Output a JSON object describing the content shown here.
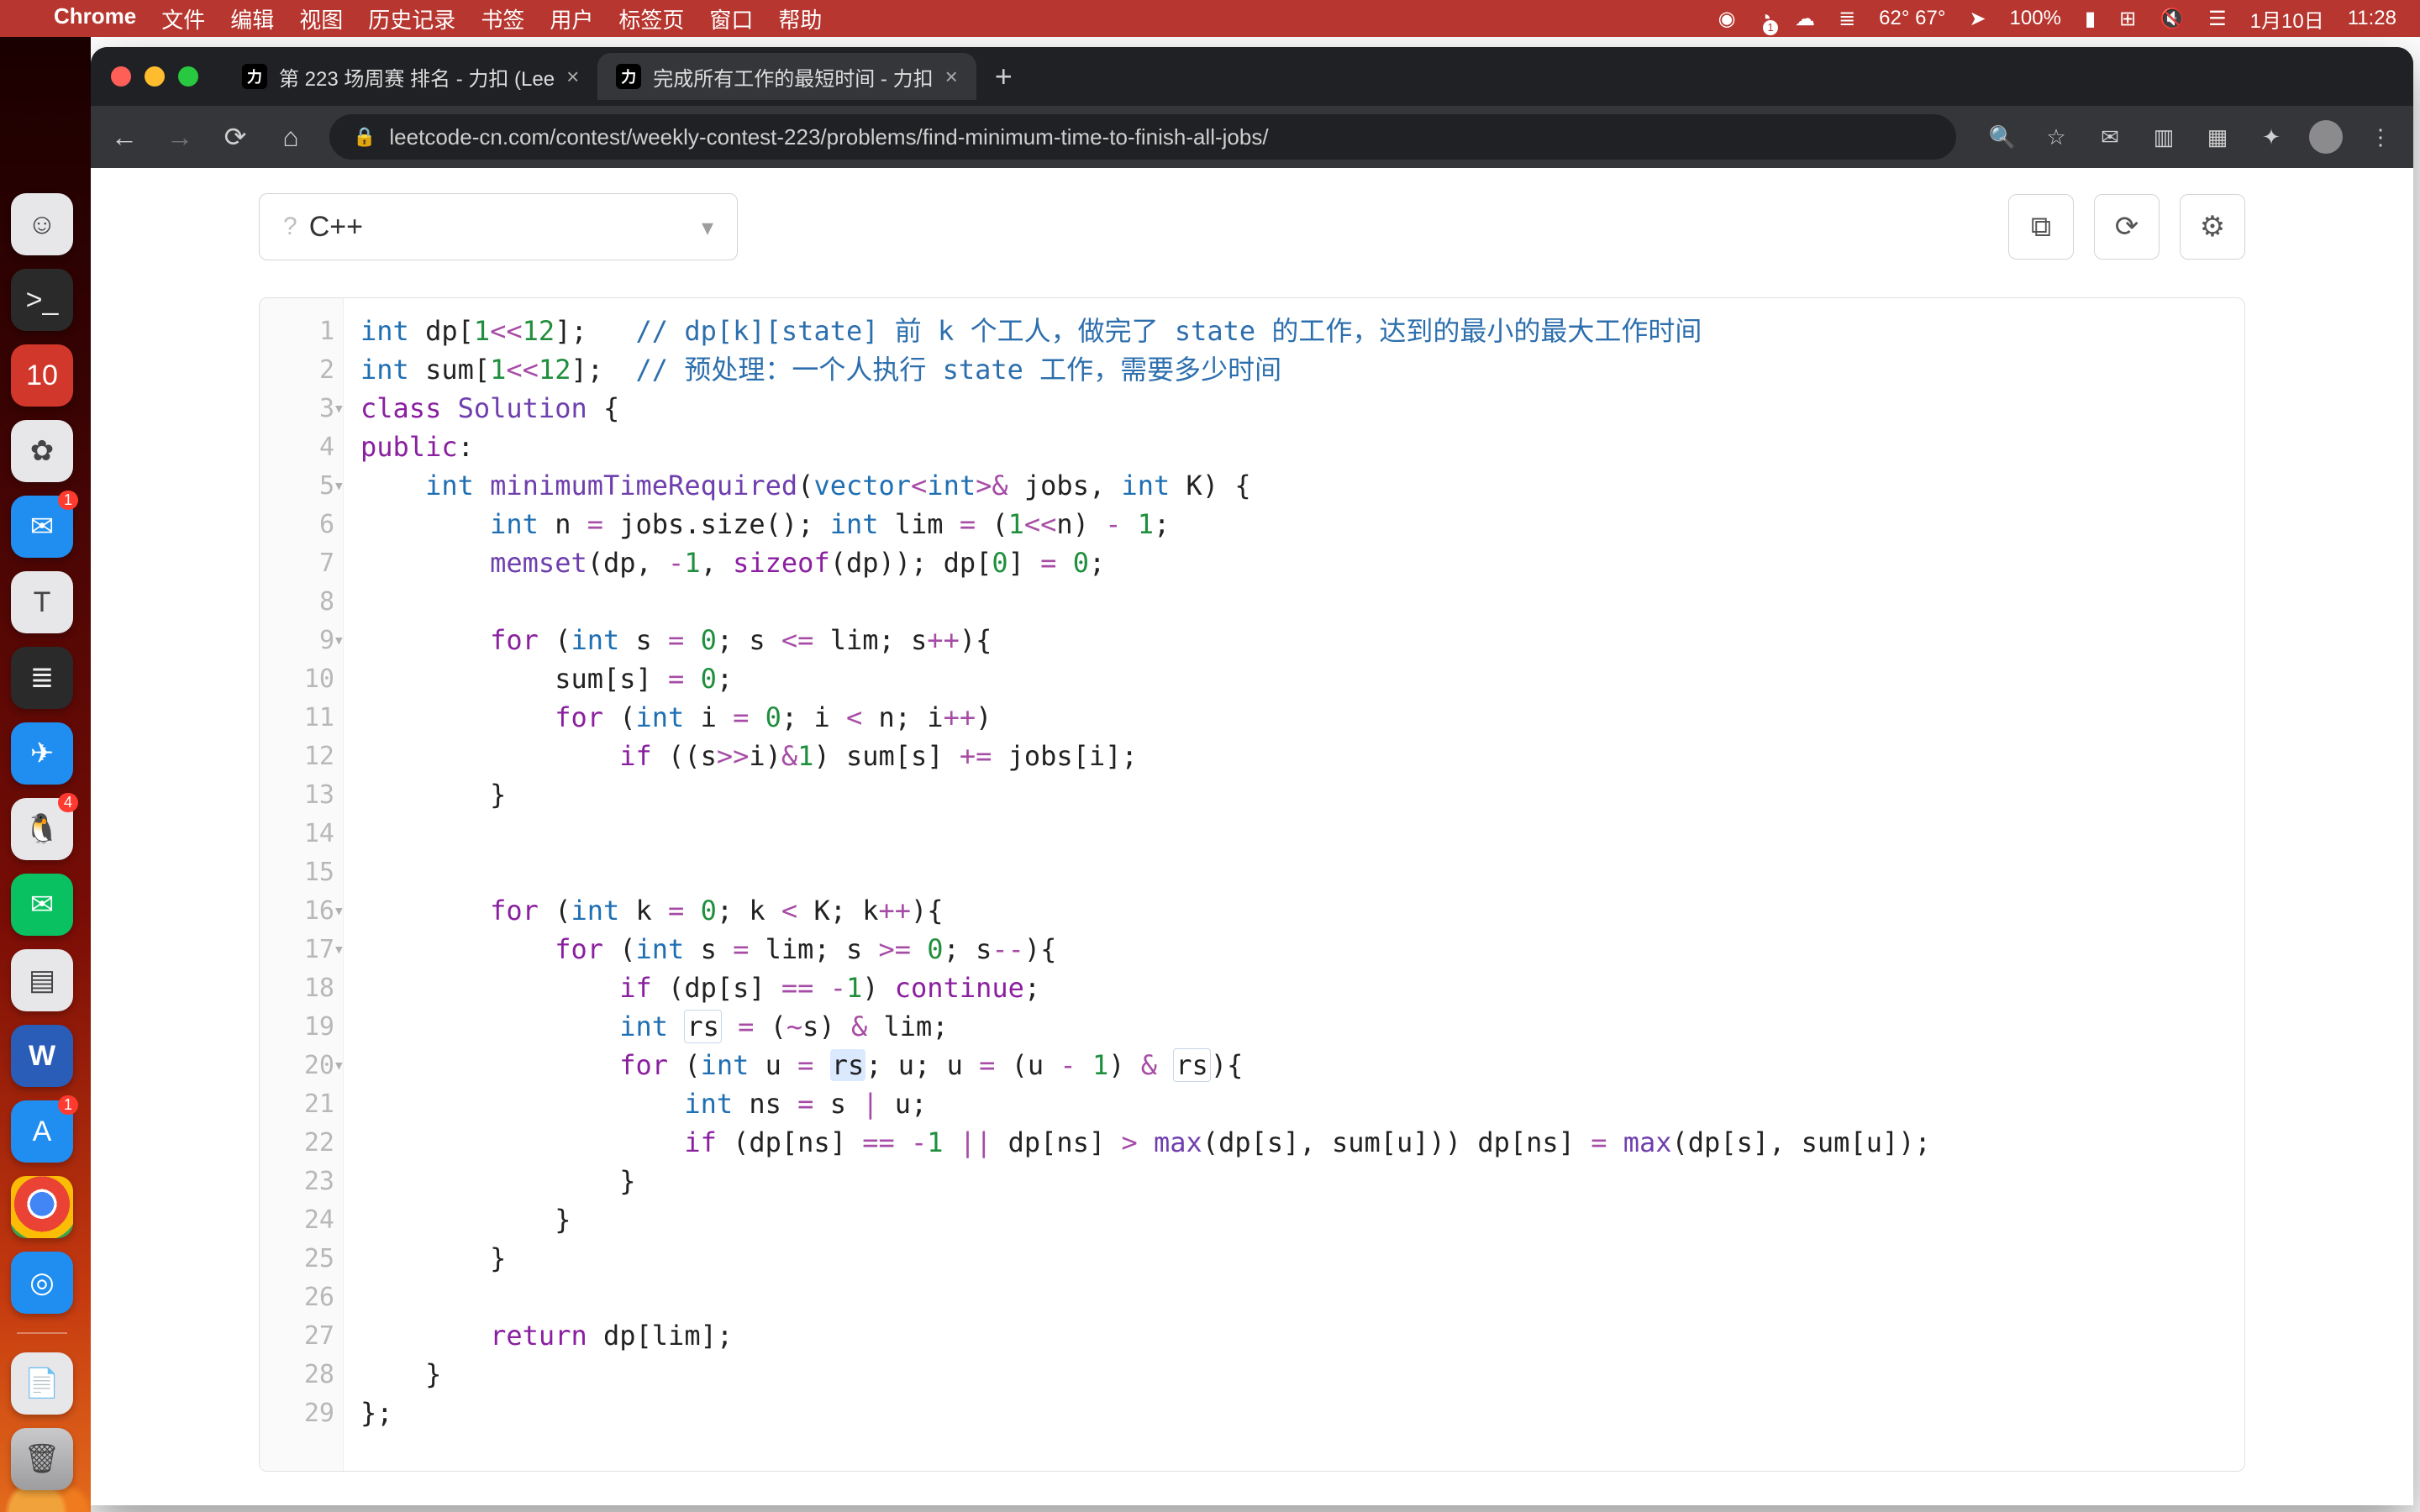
{
  "menubar": {
    "app": "Chrome",
    "menus": [
      "文件",
      "编辑",
      "视图",
      "历史记录",
      "书签",
      "用户",
      "标签页",
      "窗口",
      "帮助"
    ],
    "temp": "62° 67°",
    "battery": "100%",
    "date": "1月10日",
    "time": "11:28"
  },
  "chrome": {
    "tabs": [
      {
        "title": "第 223 场周赛 排名 - 力扣 (Lee",
        "active": false
      },
      {
        "title": "完成所有工作的最短时间 - 力扣",
        "active": true
      }
    ],
    "url": "leetcode-cn.com/contest/weekly-contest-223/problems/find-minimum-time-to-finish-all-jobs/"
  },
  "editor_toolbar": {
    "language": "C++"
  },
  "code_lines": [
    {
      "n": 1,
      "fold": "",
      "tokens": [
        [
          "type",
          "int"
        ],
        [
          "",
          " dp["
        ],
        [
          "num",
          "1"
        ],
        [
          "op",
          "<<"
        ],
        [
          "num",
          "12"
        ],
        [
          "",
          "];   "
        ],
        [
          "com",
          "// dp[k][state] 前 k 个工人，做完了 state 的工作，达到的最小的最大工作时间"
        ]
      ]
    },
    {
      "n": 2,
      "fold": "",
      "tokens": [
        [
          "type",
          "int"
        ],
        [
          "",
          " sum["
        ],
        [
          "num",
          "1"
        ],
        [
          "op",
          "<<"
        ],
        [
          "num",
          "12"
        ],
        [
          "",
          "];  "
        ],
        [
          "com",
          "// 预处理：一个人执行 state 工作，需要多少时间"
        ]
      ]
    },
    {
      "n": 3,
      "fold": "▾",
      "tokens": [
        [
          "kw",
          "class"
        ],
        [
          "",
          " "
        ],
        [
          "fn",
          "Solution"
        ],
        [
          "",
          " {"
        ]
      ]
    },
    {
      "n": 4,
      "fold": "",
      "tokens": [
        [
          "kw",
          "public"
        ],
        [
          "",
          ":"
        ]
      ]
    },
    {
      "n": 5,
      "fold": "▾",
      "tokens": [
        [
          "",
          "    "
        ],
        [
          "type",
          "int"
        ],
        [
          "",
          " "
        ],
        [
          "fn",
          "minimumTimeRequired"
        ],
        [
          "",
          "("
        ],
        [
          "type",
          "vector"
        ],
        [
          "op",
          "<"
        ],
        [
          "type",
          "int"
        ],
        [
          "op",
          ">&"
        ],
        [
          "",
          " jobs, "
        ],
        [
          "type",
          "int"
        ],
        [
          "",
          " K) {"
        ]
      ]
    },
    {
      "n": 6,
      "fold": "",
      "tokens": [
        [
          "",
          "        "
        ],
        [
          "type",
          "int"
        ],
        [
          "",
          " n "
        ],
        [
          "op",
          "="
        ],
        [
          "",
          " jobs.size(); "
        ],
        [
          "type",
          "int"
        ],
        [
          "",
          " lim "
        ],
        [
          "op",
          "="
        ],
        [
          "",
          " ("
        ],
        [
          "num",
          "1"
        ],
        [
          "op",
          "<<"
        ],
        [
          "",
          "n) "
        ],
        [
          "op",
          "-"
        ],
        [
          "",
          " "
        ],
        [
          "num",
          "1"
        ],
        [
          "",
          ";"
        ]
      ]
    },
    {
      "n": 7,
      "fold": "",
      "tokens": [
        [
          "",
          "        "
        ],
        [
          "fn",
          "memset"
        ],
        [
          "",
          "(dp, "
        ],
        [
          "op",
          "-"
        ],
        [
          "num",
          "1"
        ],
        [
          "",
          ", "
        ],
        [
          "kw",
          "sizeof"
        ],
        [
          "",
          "(dp)); dp["
        ],
        [
          "num",
          "0"
        ],
        [
          "",
          "] "
        ],
        [
          "op",
          "="
        ],
        [
          "",
          " "
        ],
        [
          "num",
          "0"
        ],
        [
          "",
          ";"
        ]
      ]
    },
    {
      "n": 8,
      "fold": "",
      "tokens": [
        [
          "",
          ""
        ]
      ]
    },
    {
      "n": 9,
      "fold": "▾",
      "tokens": [
        [
          "",
          "        "
        ],
        [
          "kw",
          "for"
        ],
        [
          "",
          " ("
        ],
        [
          "type",
          "int"
        ],
        [
          "",
          " s "
        ],
        [
          "op",
          "="
        ],
        [
          "",
          " "
        ],
        [
          "num",
          "0"
        ],
        [
          "",
          "; s "
        ],
        [
          "op",
          "<="
        ],
        [
          "",
          " lim; s"
        ],
        [
          "op",
          "++"
        ],
        [
          "",
          "){"
        ]
      ]
    },
    {
      "n": 10,
      "fold": "",
      "tokens": [
        [
          "",
          "            sum[s] "
        ],
        [
          "op",
          "="
        ],
        [
          "",
          " "
        ],
        [
          "num",
          "0"
        ],
        [
          "",
          ";"
        ]
      ]
    },
    {
      "n": 11,
      "fold": "",
      "tokens": [
        [
          "",
          "            "
        ],
        [
          "kw",
          "for"
        ],
        [
          "",
          " ("
        ],
        [
          "type",
          "int"
        ],
        [
          "",
          " i "
        ],
        [
          "op",
          "="
        ],
        [
          "",
          " "
        ],
        [
          "num",
          "0"
        ],
        [
          "",
          "; i "
        ],
        [
          "op",
          "<"
        ],
        [
          "",
          " n; i"
        ],
        [
          "op",
          "++"
        ],
        [
          "",
          ")"
        ]
      ]
    },
    {
      "n": 12,
      "fold": "",
      "tokens": [
        [
          "",
          "                "
        ],
        [
          "kw",
          "if"
        ],
        [
          "",
          " ((s"
        ],
        [
          "op",
          ">>"
        ],
        [
          "",
          "i)"
        ],
        [
          "op",
          "&"
        ],
        [
          "num",
          "1"
        ],
        [
          "",
          ") sum[s] "
        ],
        [
          "op",
          "+="
        ],
        [
          "",
          " jobs[i];"
        ]
      ]
    },
    {
      "n": 13,
      "fold": "",
      "tokens": [
        [
          "",
          "        }"
        ]
      ]
    },
    {
      "n": 14,
      "fold": "",
      "tokens": [
        [
          "",
          ""
        ]
      ]
    },
    {
      "n": 15,
      "fold": "",
      "tokens": [
        [
          "",
          ""
        ]
      ]
    },
    {
      "n": 16,
      "fold": "▾",
      "tokens": [
        [
          "",
          "        "
        ],
        [
          "kw",
          "for"
        ],
        [
          "",
          " ("
        ],
        [
          "type",
          "int"
        ],
        [
          "",
          " k "
        ],
        [
          "op",
          "="
        ],
        [
          "",
          " "
        ],
        [
          "num",
          "0"
        ],
        [
          "",
          "; k "
        ],
        [
          "op",
          "<"
        ],
        [
          "",
          " K; k"
        ],
        [
          "op",
          "++"
        ],
        [
          "",
          "){"
        ]
      ]
    },
    {
      "n": 17,
      "fold": "▾",
      "tokens": [
        [
          "",
          "            "
        ],
        [
          "kw",
          "for"
        ],
        [
          "",
          " ("
        ],
        [
          "type",
          "int"
        ],
        [
          "",
          " s "
        ],
        [
          "op",
          "="
        ],
        [
          "",
          " lim; s "
        ],
        [
          "op",
          ">="
        ],
        [
          "",
          " "
        ],
        [
          "num",
          "0"
        ],
        [
          "",
          "; s"
        ],
        [
          "op",
          "--"
        ],
        [
          "",
          "){"
        ]
      ]
    },
    {
      "n": 18,
      "fold": "",
      "tokens": [
        [
          "",
          "                "
        ],
        [
          "kw",
          "if"
        ],
        [
          "",
          " (dp[s] "
        ],
        [
          "op",
          "=="
        ],
        [
          "",
          " "
        ],
        [
          "op",
          "-"
        ],
        [
          "num",
          "1"
        ],
        [
          "",
          ") "
        ],
        [
          "kw",
          "continue"
        ],
        [
          "",
          ";"
        ]
      ]
    },
    {
      "n": 19,
      "fold": "",
      "tokens": [
        [
          "",
          "                "
        ],
        [
          "type",
          "int"
        ],
        [
          "",
          " "
        ],
        [
          "box",
          "rs"
        ],
        [
          "",
          " "
        ],
        [
          "op",
          "="
        ],
        [
          "",
          " ("
        ],
        [
          "op",
          "~"
        ],
        [
          "",
          "s) "
        ],
        [
          "op",
          "&"
        ],
        [
          "",
          " lim;"
        ]
      ]
    },
    {
      "n": 20,
      "fold": "▾",
      "tokens": [
        [
          "",
          "                "
        ],
        [
          "kw",
          "for"
        ],
        [
          "",
          " ("
        ],
        [
          "type",
          "int"
        ],
        [
          "",
          " u "
        ],
        [
          "op",
          "="
        ],
        [
          "",
          " "
        ],
        [
          "hl",
          "rs"
        ],
        [
          "",
          "; u; u "
        ],
        [
          "op",
          "="
        ],
        [
          "",
          " (u "
        ],
        [
          "op",
          "-"
        ],
        [
          "",
          " "
        ],
        [
          "num",
          "1"
        ],
        [
          "",
          ") "
        ],
        [
          "op",
          "&"
        ],
        [
          "",
          " "
        ],
        [
          "box",
          "rs"
        ],
        [
          "",
          "){"
        ]
      ]
    },
    {
      "n": 21,
      "fold": "",
      "tokens": [
        [
          "",
          "                    "
        ],
        [
          "type",
          "int"
        ],
        [
          "",
          " ns "
        ],
        [
          "op",
          "="
        ],
        [
          "",
          " s "
        ],
        [
          "op",
          "|"
        ],
        [
          "",
          " u;"
        ]
      ]
    },
    {
      "n": 22,
      "fold": "",
      "tokens": [
        [
          "",
          "                    "
        ],
        [
          "kw",
          "if"
        ],
        [
          "",
          " (dp[ns] "
        ],
        [
          "op",
          "=="
        ],
        [
          "",
          " "
        ],
        [
          "op",
          "-"
        ],
        [
          "num",
          "1"
        ],
        [
          "",
          " "
        ],
        [
          "op",
          "||"
        ],
        [
          "",
          " dp[ns] "
        ],
        [
          "op",
          ">"
        ],
        [
          "",
          " "
        ],
        [
          "fn",
          "max"
        ],
        [
          "",
          "(dp[s], sum[u])) dp[ns] "
        ],
        [
          "op",
          "="
        ],
        [
          "",
          " "
        ],
        [
          "fn",
          "max"
        ],
        [
          "",
          "(dp[s], sum[u]);"
        ]
      ]
    },
    {
      "n": 23,
      "fold": "",
      "tokens": [
        [
          "",
          "                }"
        ]
      ]
    },
    {
      "n": 24,
      "fold": "",
      "tokens": [
        [
          "",
          "            }"
        ]
      ]
    },
    {
      "n": 25,
      "fold": "",
      "tokens": [
        [
          "",
          "        }"
        ]
      ]
    },
    {
      "n": 26,
      "fold": "",
      "tokens": [
        [
          "",
          ""
        ]
      ]
    },
    {
      "n": 27,
      "fold": "",
      "tokens": [
        [
          "",
          "        "
        ],
        [
          "kw",
          "return"
        ],
        [
          "",
          " dp[lim];"
        ]
      ]
    },
    {
      "n": 28,
      "fold": "",
      "tokens": [
        [
          "",
          "    }"
        ]
      ]
    },
    {
      "n": 29,
      "fold": "",
      "tokens": [
        [
          "",
          "};"
        ]
      ]
    }
  ],
  "dock": {
    "items": [
      {
        "name": "finder",
        "cls": "",
        "glyph": "☺",
        "badge": ""
      },
      {
        "name": "terminal",
        "cls": "dark",
        "glyph": ">_",
        "badge": ""
      },
      {
        "name": "calendar",
        "cls": "red",
        "glyph": "10",
        "badge": ""
      },
      {
        "name": "photos",
        "cls": "",
        "glyph": "✿",
        "badge": ""
      },
      {
        "name": "mail",
        "cls": "blue",
        "glyph": "✉",
        "badge": "1"
      },
      {
        "name": "textedit",
        "cls": "",
        "glyph": "T",
        "badge": ""
      },
      {
        "name": "sublime",
        "cls": "dark",
        "glyph": "≣",
        "badge": ""
      },
      {
        "name": "telegram",
        "cls": "blue",
        "glyph": "✈",
        "badge": ""
      },
      {
        "name": "qq",
        "cls": "",
        "glyph": "🐧",
        "badge": "4"
      },
      {
        "name": "wechat",
        "cls": "grn",
        "glyph": "✉",
        "badge": ""
      },
      {
        "name": "preview",
        "cls": "",
        "glyph": "▤",
        "badge": ""
      },
      {
        "name": "word",
        "cls": "w",
        "glyph": "W",
        "badge": ""
      },
      {
        "name": "app-store",
        "cls": "blue",
        "glyph": "A",
        "badge": "1"
      },
      {
        "name": "chrome",
        "cls": "chrome",
        "glyph": "",
        "badge": ""
      },
      {
        "name": "safari",
        "cls": "blue",
        "glyph": "◎",
        "badge": ""
      }
    ],
    "after_sep": [
      {
        "name": "doc",
        "cls": "",
        "glyph": "📄"
      },
      {
        "name": "trash",
        "cls": "trash",
        "glyph": "🗑"
      }
    ]
  }
}
